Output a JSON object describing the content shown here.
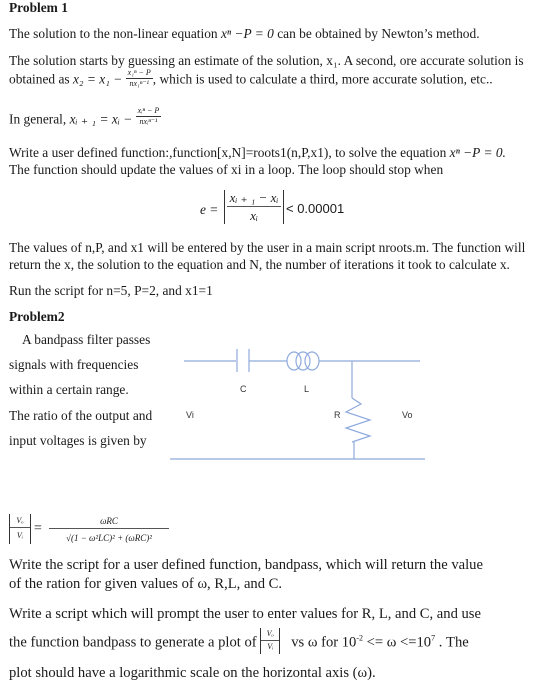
{
  "problem1": {
    "title": "Problem 1",
    "p1_a": "The solution to the non-linear equation ",
    "p1_eq": "xⁿ −P = 0",
    "p1_b": " can be obtained by Newton’s method.",
    "p2_line1": "The solution starts by guessing an estimate of the solution, x₁. A second, ore accurate solution is",
    "p2_line2_a": "obtained as ",
    "p2_eq_lhs": "x₂ = x₁ −",
    "p2_frac_num": "x₁ⁿ − P",
    "p2_frac_den": "nx₁ⁿ⁻¹",
    "p2_line2_b": ", which is used to calculate a third, more accurate solution, etc..",
    "p3_a": "In general, ",
    "p3_eq_lhs": "xᵢ ₊ ₁ = xᵢ −",
    "p3_frac_num": "xᵢⁿ − P",
    "p3_frac_den": "nxᵢⁿ⁻¹",
    "p4_line1_a": "Write a user defined function:,function[x,N]=roots1(n,P,x1), to solve the equation ",
    "p4_eq": "xⁿ −P = 0.",
    "p4_line2": "The function should update the values of xi in a loop. The loop should stop when",
    "stop_lhs": "e =",
    "stop_num": "xᵢ ₊ ₁ − xᵢ",
    "stop_den": "xᵢ",
    "stop_rhs": "< 0.00001",
    "p5_line1": "The values of n,P, and x1 will be entered by the user in a main script nroots.m. The function will",
    "p5_line2": "return the x, the solution to the equation and N, the number of iterations it took to calculate x.",
    "p6": "Run the script for n=5, P=2, and x1=1"
  },
  "problem2": {
    "title": "Problem2",
    "side_lines": [
      "A bandpass filter passes",
      "signals with frequencies",
      "within a certain range.",
      "The ratio of the output and",
      "input voltages is given by"
    ],
    "circuit": {
      "label_c": "C",
      "label_l": "L",
      "label_r": "R",
      "label_vi": "Vi",
      "label_vo": "Vo",
      "line_color": "#8faadc"
    },
    "ratio_num": "Vₒ",
    "ratio_den": "Vᵢ",
    "formula_num": "ωRC",
    "formula_den": "√(1 − ω²LC)² + (ωRC)²",
    "q1_line1": "Write the script for a  user defined function, bandpass, which will return the value",
    "q1_line2": "of the ration for given values of ω, R,L, and C.",
    "q2_line1": "Write a script which will prompt the user to enter values for R, L, and C, and use",
    "q2_line2_a": "the function bandpass to generate a plot of",
    "q2_line2_b": "vs ω  for 10",
    "q2_exp1": "-2",
    "q2_line2_c": " <=  ω <=10",
    "q2_exp2": "7",
    "q2_line2_d": " . The",
    "q2_line3": "plot should have a logarithmic scale on the horizontal axis (ω)."
  }
}
